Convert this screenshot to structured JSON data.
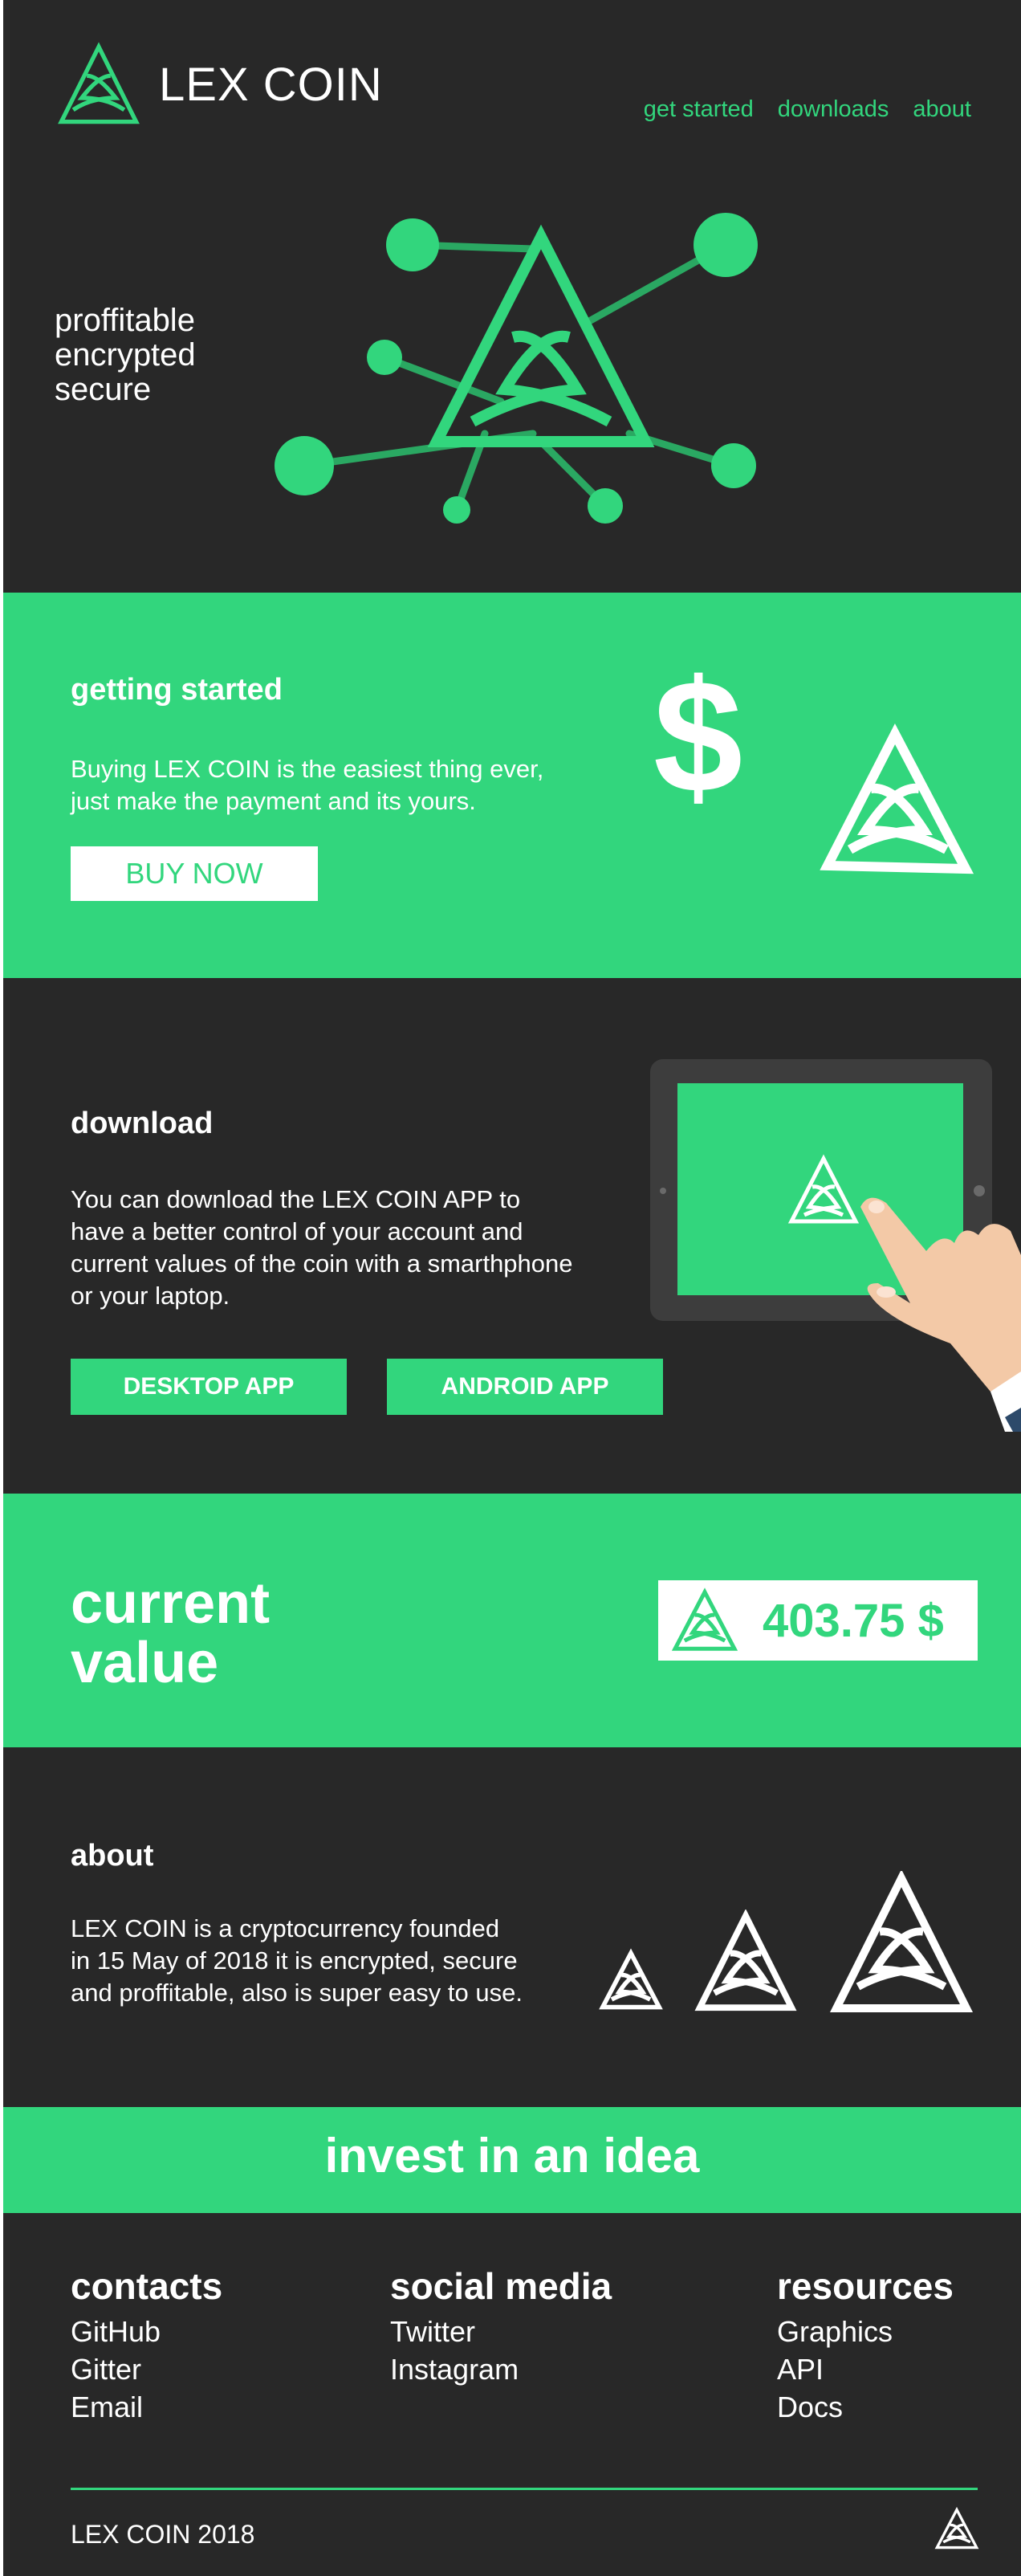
{
  "header": {
    "brand_lex": "LEX",
    "brand_coin": "COIN",
    "nav": [
      {
        "label": "get started"
      },
      {
        "label": "downloads"
      },
      {
        "label": "about"
      }
    ]
  },
  "hero": {
    "tagline": [
      "proffitable",
      "encrypted",
      "secure"
    ]
  },
  "getting_started": {
    "title": "getting started",
    "body": [
      "Buying LEX COIN is the easiest thing ever,",
      "just make the payment and its yours."
    ],
    "buy_label": "BUY NOW",
    "dollar_symbol": "$"
  },
  "download": {
    "title": "download",
    "body": [
      "You can download the LEX COIN APP to",
      "have a better control of your account and",
      "current values of the coin with a smarthphone",
      "or your laptop."
    ],
    "desktop_label": "DESKTOP APP",
    "android_label": "ANDROID APP"
  },
  "current_value": {
    "title_line1": "current",
    "title_line2": "value",
    "value": "403.75 $"
  },
  "about": {
    "title": "about",
    "body": [
      "LEX COIN is a cryptocurrency founded",
      "in 15 May of 2018 it is encrypted, secure",
      "and proffitable, also is super easy to use."
    ]
  },
  "invest": {
    "text": "invest in an idea"
  },
  "footer": {
    "contacts": {
      "title": "contacts",
      "links": [
        "GitHub",
        "Gitter",
        "Email"
      ]
    },
    "social": {
      "title": "social media",
      "links": [
        "Twitter",
        "Instagram"
      ]
    },
    "resources": {
      "title": "resources",
      "links": [
        "Graphics",
        "API",
        "Docs"
      ]
    },
    "copy_brand": "LEX COIN",
    "copy_year": "2018"
  },
  "colors": {
    "accent": "#32d67d",
    "dark": "#282828",
    "white": "#ffffff"
  }
}
